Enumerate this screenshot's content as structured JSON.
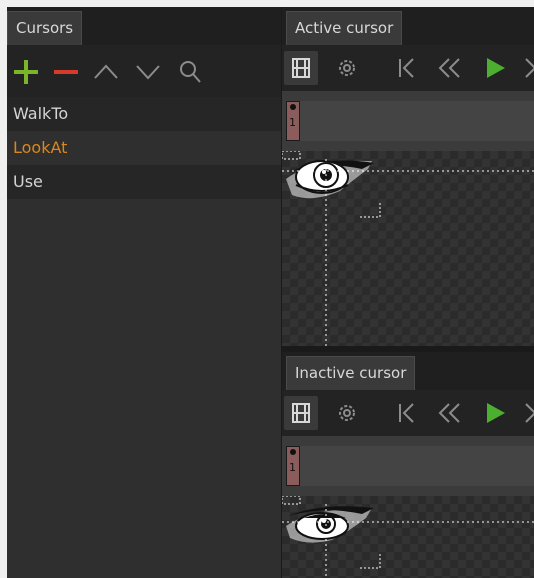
{
  "left": {
    "tab_label": "Cursors",
    "toolbar": {
      "add_icon": "plus-icon",
      "remove_icon": "minus-icon",
      "move_up_icon": "chevron-up-icon",
      "move_down_icon": "chevron-down-icon",
      "search_icon": "search-icon"
    },
    "items": [
      {
        "label": "WalkTo"
      },
      {
        "label": "LookAt"
      },
      {
        "label": "Use"
      }
    ]
  },
  "active": {
    "tab_label": "Active cursor",
    "frame_number": "1"
  },
  "inactive": {
    "tab_label": "Inactive cursor",
    "frame_number": "1"
  },
  "colors": {
    "add": "#7bb52a",
    "remove": "#d63a2a",
    "play": "#4caf30",
    "selected_text": "#d9881a"
  }
}
